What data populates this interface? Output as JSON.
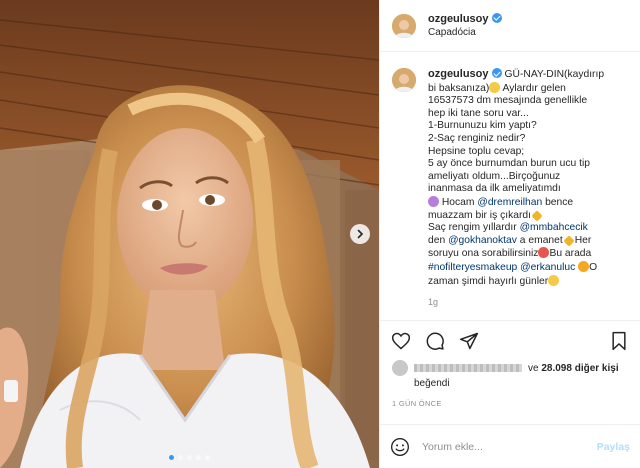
{
  "post": {
    "username": "ozgeulusoy",
    "location": "Capadócia",
    "caption_lines": [
      "GÜ-NAY-DIN(kaydırıp",
      "bi baksanıza)",
      "Aylardır gelen",
      "16537573 dm mesajında genellikle",
      "hep iki tane soru var...",
      "1-Burnunuzu kim yaptı?",
      "2-Saç renginiz nedir?",
      "Hepsine toplu cevap;",
      "5 ay önce burnumdan burun ucu tip",
      "ameliyatı oldum...Birçoğunuz",
      "inanmasa da ilk ameliyatımdı",
      "Hocam",
      "bence",
      "muazzam bir iş çıkardı",
      "Saç rengim yıllardır",
      "den",
      "a emanet",
      "Her",
      "soruyu ona sorabilirsiniz",
      "Bu arada",
      "O",
      "zaman şimdi hayırlı günler"
    ],
    "mentions": {
      "drem": "@dremreilhan",
      "mmb": "@mmbahcecik",
      "gokhan": "@gokhanoktav",
      "hashtag": "#nofilteryesmakeup",
      "erkan": "@erkanuluc"
    },
    "caption_age": "1g",
    "likes_prefix": "ve",
    "likes_count": "28.098 diğer kişi",
    "liked_label": "beğendi",
    "date": "1 GÜN ÖNCE",
    "comment_placeholder": "Yorum ekle...",
    "post_button": "Paylaş"
  },
  "carousel": {
    "count": 5,
    "active_index": 0
  },
  "colors": {
    "verified": "#3897f0",
    "link": "#00376b",
    "post_button_disabled": "#b2dffc"
  },
  "icons": [
    "chevron-right-icon",
    "heart-icon",
    "comment-icon",
    "share-icon",
    "bookmark-icon",
    "emoji-icon",
    "verified-icon"
  ]
}
